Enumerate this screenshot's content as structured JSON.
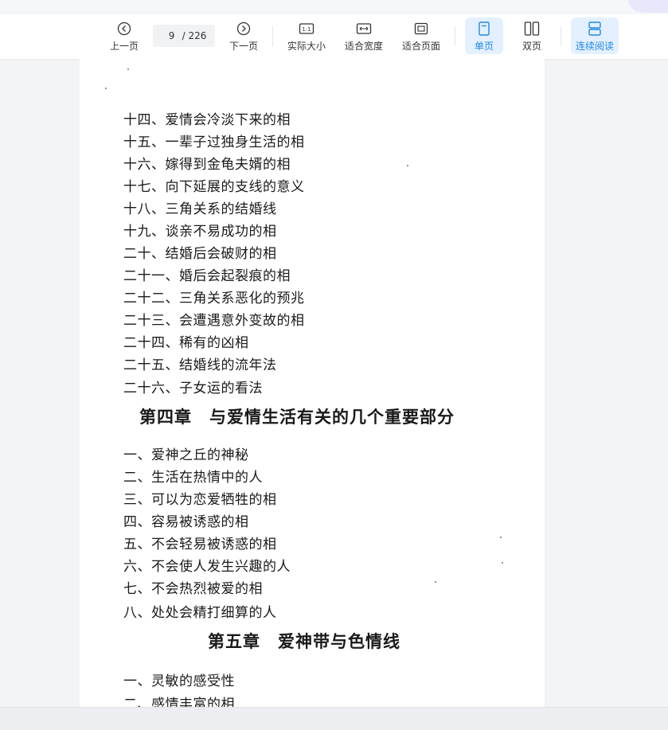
{
  "toolbar": {
    "prev_label": "上一页",
    "next_label": "下一页",
    "current_page": "9",
    "total_pages": "/ 226",
    "actual_size_label": "实际大小",
    "fit_width_label": "适合宽度",
    "fit_page_label": "适合页面",
    "single_page_label": "单页",
    "double_page_label": "双页",
    "continuous_label": "连续阅读"
  },
  "document": {
    "lines_a": [
      "十四、爱情会冷淡下来的相",
      "十五、一辈子过独身生活的相",
      "十六、嫁得到金龟夫婿的相",
      "十七、向下延展的支线的意义",
      "十八、三角关系的结婚线",
      "十九、谈亲不易成功的相",
      "二十、结婚后会破财的相",
      "二十一、婚后会起裂痕的相",
      "二十二、三角关系恶化的预兆",
      "二十三、会遭遇意外变故的相",
      "二十四、稀有的凶相",
      "二十五、结婚线的流年法",
      "二十六、子女运的看法"
    ],
    "chapter4": "第四章　与爱情生活有关的几个重要部分",
    "lines_b": [
      "一、爱神之丘的神秘",
      "二、生活在热情中的人",
      "三、可以为恋爱牺牲的相",
      "四、容易被诱惑的相",
      "五、不会轻易被诱惑的相",
      "六、不会使人发生兴趣的人",
      "七、不会热烈被爱的相",
      "八、处处会精打细算的人"
    ],
    "chapter5": "第五章　爱神带与色情线",
    "lines_c": [
      "一、灵敏的感受性",
      "二、感情丰富的相"
    ]
  },
  "colors": {
    "accent": "#1e88e5",
    "active_bg": "#e4f0ff",
    "viewer_bg": "#f3f4f6"
  },
  "icons": [
    "chevron-left-circle-icon",
    "chevron-right-circle-icon",
    "actual-size-icon",
    "fit-width-icon",
    "fit-page-icon",
    "single-page-icon",
    "double-page-icon",
    "continuous-icon"
  ]
}
